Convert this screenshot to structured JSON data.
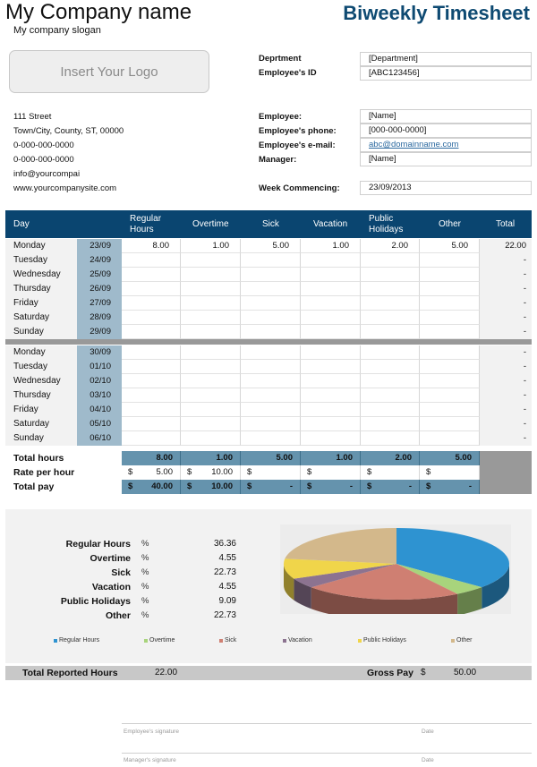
{
  "header": {
    "company_name": "My Company name",
    "slogan": "My company slogan",
    "title": "Biweekly Timesheet",
    "logo_placeholder": "Insert Your Logo"
  },
  "company_address": [
    "111 Street",
    "Town/City, County, ST, 00000",
    "0-000-000-0000",
    "0-000-000-0000",
    "info@yourcompai",
    "www.yourcompanysite.com"
  ],
  "fields": {
    "department": {
      "label": "Deprtment",
      "value": "[Department]"
    },
    "employee_id": {
      "label": "Employee's ID",
      "value": "[ABC123456]"
    },
    "employee": {
      "label": "Employee:",
      "value": "[Name]"
    },
    "phone": {
      "label": "Employee's phone:",
      "value": "[000-000-0000]"
    },
    "email": {
      "label": "Employee's e-mail:",
      "value": "abc@domainname.com"
    },
    "manager": {
      "label": "Manager:",
      "value": "[Name]"
    },
    "week_commencing": {
      "label": "Week Commencing:",
      "value": "23/09/2013"
    }
  },
  "table": {
    "columns": {
      "day": "Day",
      "regular_line1": "Regular",
      "regular_line2": "Hours",
      "overtime": "Overtime",
      "sick": "Sick",
      "vacation": "Vacation",
      "ph_line1": "Public",
      "ph_line2": "Holidays",
      "other": "Other",
      "total": "Total"
    },
    "week1": [
      {
        "day": "Monday",
        "date": "23/09",
        "regular": "8.00",
        "overtime": "1.00",
        "sick": "5.00",
        "vacation": "1.00",
        "public_holidays": "2.00",
        "other": "5.00",
        "total": "22.00"
      },
      {
        "day": "Tuesday",
        "date": "24/09",
        "regular": "",
        "overtime": "",
        "sick": "",
        "vacation": "",
        "public_holidays": "",
        "other": "",
        "total": "-"
      },
      {
        "day": "Wednesday",
        "date": "25/09",
        "regular": "",
        "overtime": "",
        "sick": "",
        "vacation": "",
        "public_holidays": "",
        "other": "",
        "total": "-"
      },
      {
        "day": "Thursday",
        "date": "26/09",
        "regular": "",
        "overtime": "",
        "sick": "",
        "vacation": "",
        "public_holidays": "",
        "other": "",
        "total": "-"
      },
      {
        "day": "Friday",
        "date": "27/09",
        "regular": "",
        "overtime": "",
        "sick": "",
        "vacation": "",
        "public_holidays": "",
        "other": "",
        "total": "-"
      },
      {
        "day": "Saturday",
        "date": "28/09",
        "regular": "",
        "overtime": "",
        "sick": "",
        "vacation": "",
        "public_holidays": "",
        "other": "",
        "total": "-"
      },
      {
        "day": "Sunday",
        "date": "29/09",
        "regular": "",
        "overtime": "",
        "sick": "",
        "vacation": "",
        "public_holidays": "",
        "other": "",
        "total": "-"
      }
    ],
    "week2": [
      {
        "day": "Monday",
        "date": "30/09",
        "regular": "",
        "overtime": "",
        "sick": "",
        "vacation": "",
        "public_holidays": "",
        "other": "",
        "total": "-"
      },
      {
        "day": "Tuesday",
        "date": "01/10",
        "regular": "",
        "overtime": "",
        "sick": "",
        "vacation": "",
        "public_holidays": "",
        "other": "",
        "total": "-"
      },
      {
        "day": "Wednesday",
        "date": "02/10",
        "regular": "",
        "overtime": "",
        "sick": "",
        "vacation": "",
        "public_holidays": "",
        "other": "",
        "total": "-"
      },
      {
        "day": "Thursday",
        "date": "03/10",
        "regular": "",
        "overtime": "",
        "sick": "",
        "vacation": "",
        "public_holidays": "",
        "other": "",
        "total": "-"
      },
      {
        "day": "Friday",
        "date": "04/10",
        "regular": "",
        "overtime": "",
        "sick": "",
        "vacation": "",
        "public_holidays": "",
        "other": "",
        "total": "-"
      },
      {
        "day": "Saturday",
        "date": "05/10",
        "regular": "",
        "overtime": "",
        "sick": "",
        "vacation": "",
        "public_holidays": "",
        "other": "",
        "total": "-"
      },
      {
        "day": "Sunday",
        "date": "06/10",
        "regular": "",
        "overtime": "",
        "sick": "",
        "vacation": "",
        "public_holidays": "",
        "other": "",
        "total": "-"
      }
    ],
    "summary": {
      "total_hours_label": "Total hours",
      "rate_label": "Rate per hour",
      "total_pay_label": "Total pay",
      "currency": "$",
      "total_hours": [
        "8.00",
        "1.00",
        "5.00",
        "1.00",
        "2.00",
        "5.00"
      ],
      "rate": [
        "5.00",
        "10.00",
        "",
        "",
        "",
        ""
      ],
      "total_pay": [
        "40.00",
        "10.00",
        "-",
        "-",
        "-",
        "-"
      ]
    }
  },
  "breakdown": {
    "percent_symbol": "%",
    "items": [
      {
        "label": "Regular Hours",
        "value": "36.36"
      },
      {
        "label": "Overtime",
        "value": "4.55"
      },
      {
        "label": "Sick",
        "value": "22.73"
      },
      {
        "label": "Vacation",
        "value": "4.55"
      },
      {
        "label": "Public Holidays",
        "value": "9.09"
      },
      {
        "label": "Other",
        "value": "22.73"
      }
    ]
  },
  "chart_data": {
    "type": "pie",
    "title": "",
    "categories": [
      "Regular Hours",
      "Overtime",
      "Sick",
      "Vacation",
      "Public Holidays",
      "Other"
    ],
    "values": [
      36.36,
      4.55,
      22.73,
      4.55,
      9.09,
      22.73
    ],
    "colors": [
      "#2e93d1",
      "#a8d47c",
      "#cf7f72",
      "#8c7390",
      "#f0d54a",
      "#d3b88b"
    ],
    "legend_position": "bottom",
    "style": "3d"
  },
  "totals": {
    "reported_hours_label": "Total Reported Hours",
    "reported_hours": "22.00",
    "gross_pay_label": "Gross Pay",
    "currency": "$",
    "gross_pay": "50.00"
  },
  "signatures": {
    "employee_label": "Employee's signature",
    "manager_label": "Manager's signature",
    "date_label": "Date"
  }
}
